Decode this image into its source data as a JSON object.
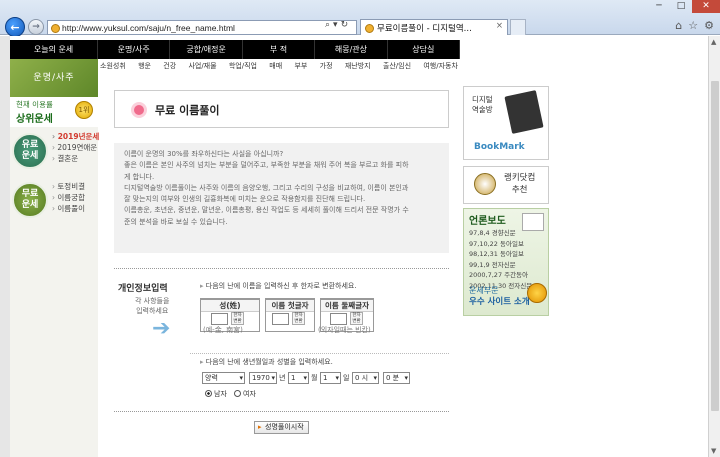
{
  "browser": {
    "url": "http://www.yuksul.com/saju/n_free_name.html",
    "tab_title": "무료이름풀이 - 디지털역...",
    "tab_close": "×"
  },
  "top_menu": [
    "오늘의 운세",
    "운명/사주",
    "궁합/애정운",
    "부 적",
    "해몽/관상",
    "상담실"
  ],
  "sub_menu": [
    "소원성취",
    "행운",
    "건강",
    "사업/재물",
    "학업/직업",
    "매매",
    "부부",
    "가정",
    "재난방지",
    "출산/임신",
    "여행/자동차"
  ],
  "sidebar": {
    "logo": "운명/사주",
    "promo_line1": "현재 이용률",
    "promo_line2": "상위운세",
    "promo_badge": "1위",
    "group1_icon": "유료\n운세",
    "group1_items": [
      "2019년운세",
      "2019연애운",
      "결혼운"
    ],
    "group2_icon": "무료\n운세",
    "group2_items": [
      "토정비결",
      "이름궁합",
      "이름풀이"
    ]
  },
  "main": {
    "title": "무료 이름풀이",
    "desc": [
      "이름이 운명의 30%를 좌우하신다는 사실을 아십니까?",
      "좋은 이름은 본인 사주의 넘치는 부분을 덜어주고, 부족한 부분을 채워 주어 복을 부르고 화를 피하",
      "게 합니다.",
      "디지털역술방 이름풀이는 사주와 이름의 음양오행, 그리고 수리의 구성을 비교하여, 이름이 본인과",
      "잘 맞는지의 여부와 인생의 길흉화복에 미치는 운으로 작용함지를 진단해 드립니다.",
      "이름총운, 초년운, 중년운, 말년운, 이름총평, 용신 작업도 등 세세히 풀이해 드리서 전문 작명가 수",
      "준의 분석을 바로 보실 수 있습니다."
    ]
  },
  "form": {
    "section_title": "개인정보입력",
    "section_desc": "각 사항들을\n입력하세요",
    "name_instruction": "다음의 난에 이름을 입력하신 후 한자로 변환하세요.",
    "surname_label": "성(姓)",
    "first_char_label": "이름 첫글자",
    "second_char_label": "이름 둘째글자",
    "hanja_button": "한자\n변환",
    "surname_hint": "(예-金, 南宮)",
    "second_hint": "(외자일때는 빈칸)",
    "birth_instruction": "다음의 난에 생년월일과 성별을 입력하세요.",
    "calendar": "양력",
    "year": "1970",
    "year_unit": "년",
    "month": "1",
    "month_unit": "월",
    "day": "1",
    "day_unit": "일",
    "hour": "0 시",
    "minute": "0 분",
    "male": "남자",
    "female": "여자",
    "submit": "성명풀이시작"
  },
  "right": {
    "bookmark_line1": "디지털",
    "bookmark_line2": "역술방",
    "bookmark_label": "BookMark",
    "rank_line1": "랭키닷컴",
    "rank_line2": "추천",
    "press_title": "언론보도",
    "press_rows": [
      "97,8,4  경향신문",
      "97,10,22  동아일보",
      "98,12,31  동아일보",
      "99,1,9  전자신문",
      "2000,7,27  주간동아",
      "2002,11,30  전자신문"
    ],
    "sub_label": "운세부문",
    "best_label": "우수 사이트 소개"
  },
  "win": {
    "min": "─",
    "max": "□",
    "close": "✕"
  },
  "icons": {
    "back": "←",
    "fwd": "→",
    "search": "⌕",
    "refresh": "↻",
    "dropdown": "▾"
  }
}
